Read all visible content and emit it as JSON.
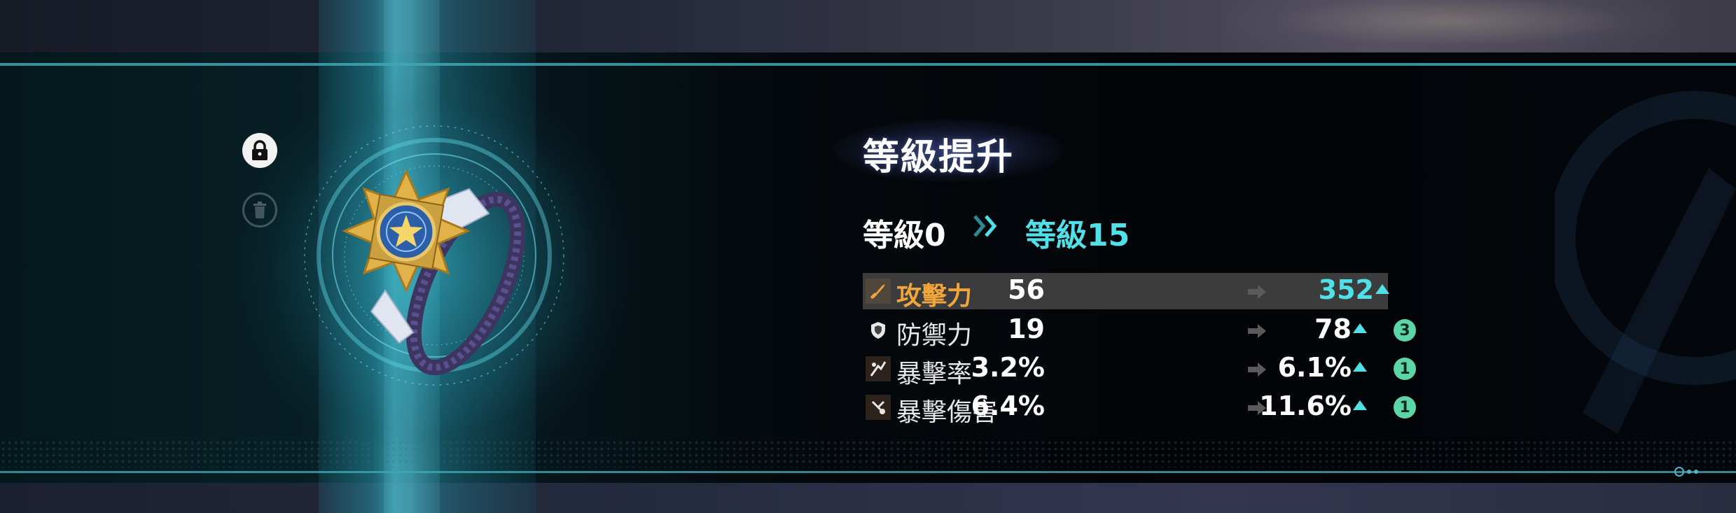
{
  "title": "等級提升",
  "level": {
    "from": "等級0",
    "to": "等級15"
  },
  "stats": [
    {
      "name": "攻擊力",
      "icon": "sword-icon",
      "before": "56",
      "after": "352",
      "badge": "",
      "highlight": true
    },
    {
      "name": "防禦力",
      "icon": "shield-icon",
      "before": "19",
      "after": "78",
      "badge": "3",
      "highlight": false
    },
    {
      "name": "暴擊率",
      "icon": "crit-rate-icon",
      "before": "3.2%",
      "after": "6.1%",
      "badge": "1",
      "highlight": false
    },
    {
      "name": "暴擊傷害",
      "icon": "crit-damage-icon",
      "before": "6.4%",
      "after": "11.6%",
      "badge": "1",
      "highlight": false
    }
  ],
  "colors": {
    "accent": "#4fe0e8",
    "highlight_text": "#f2a63a",
    "badge": "#5cd6a6",
    "row_highlight": "#3c3c3c"
  },
  "item": {
    "icon": "star-bracelet-icon",
    "locked": true
  }
}
